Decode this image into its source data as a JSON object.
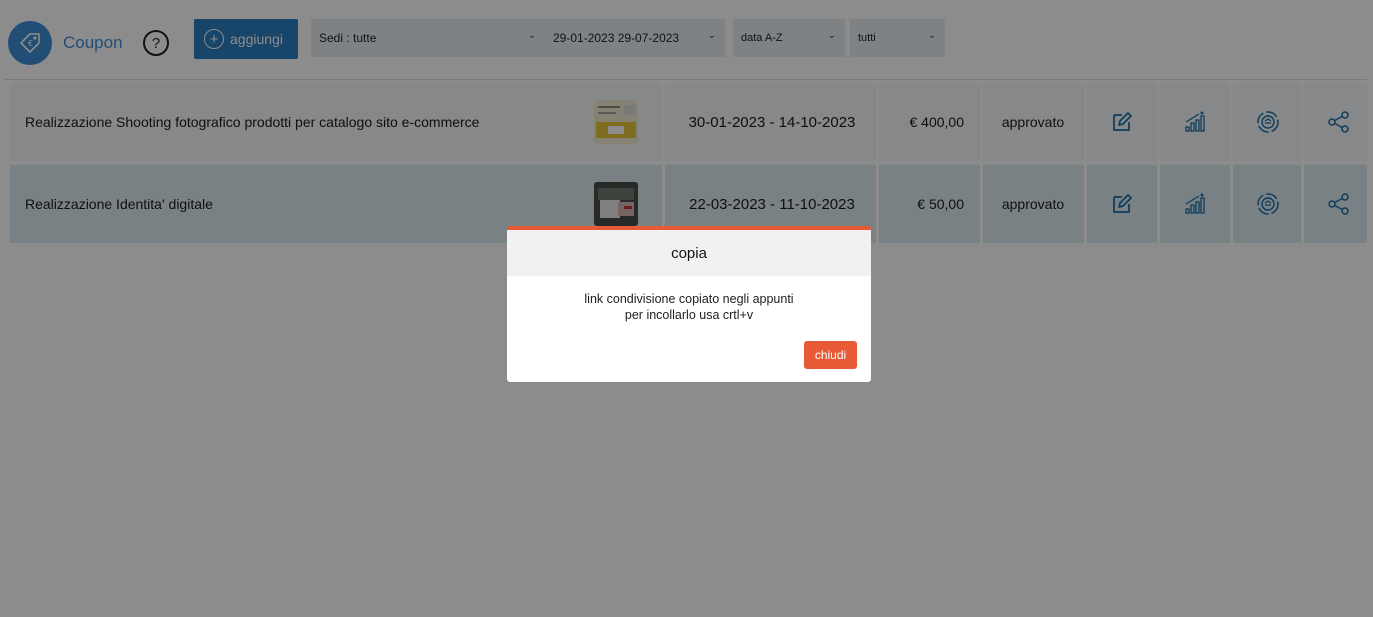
{
  "header": {
    "title": "Coupon",
    "help_label": "?",
    "add_label": "aggiungi",
    "filters": {
      "sedi": "Sedi : tutte",
      "date_range": "29-01-2023 29-07-2023",
      "order": "data A-Z",
      "status": "tutti"
    }
  },
  "items": [
    {
      "title": "Realizzazione Shooting fotografico prodotti per catalogo sito e-commerce",
      "dates": "30-01-2023 - 14-10-2023",
      "price": "€ 400,00",
      "status": "approvato"
    },
    {
      "title": "Realizzazione Identita' digitale",
      "dates": "22-03-2023 - 11-10-2023",
      "price": "€ 50,00",
      "status": "approvato"
    }
  ],
  "icons": {
    "logo": "coupon-tag-icon",
    "edit": "edit-icon",
    "stats": "stats-icon",
    "target": "target-icon",
    "share": "share-icon"
  },
  "dialog": {
    "title": "copia",
    "line1": "link condivisione copiato negli appunti",
    "line2": "per incollarlo usa crtl+v",
    "close_label": "chiudi"
  },
  "colors": {
    "brand": "#3e8fd6",
    "accent": "#e85a36"
  }
}
